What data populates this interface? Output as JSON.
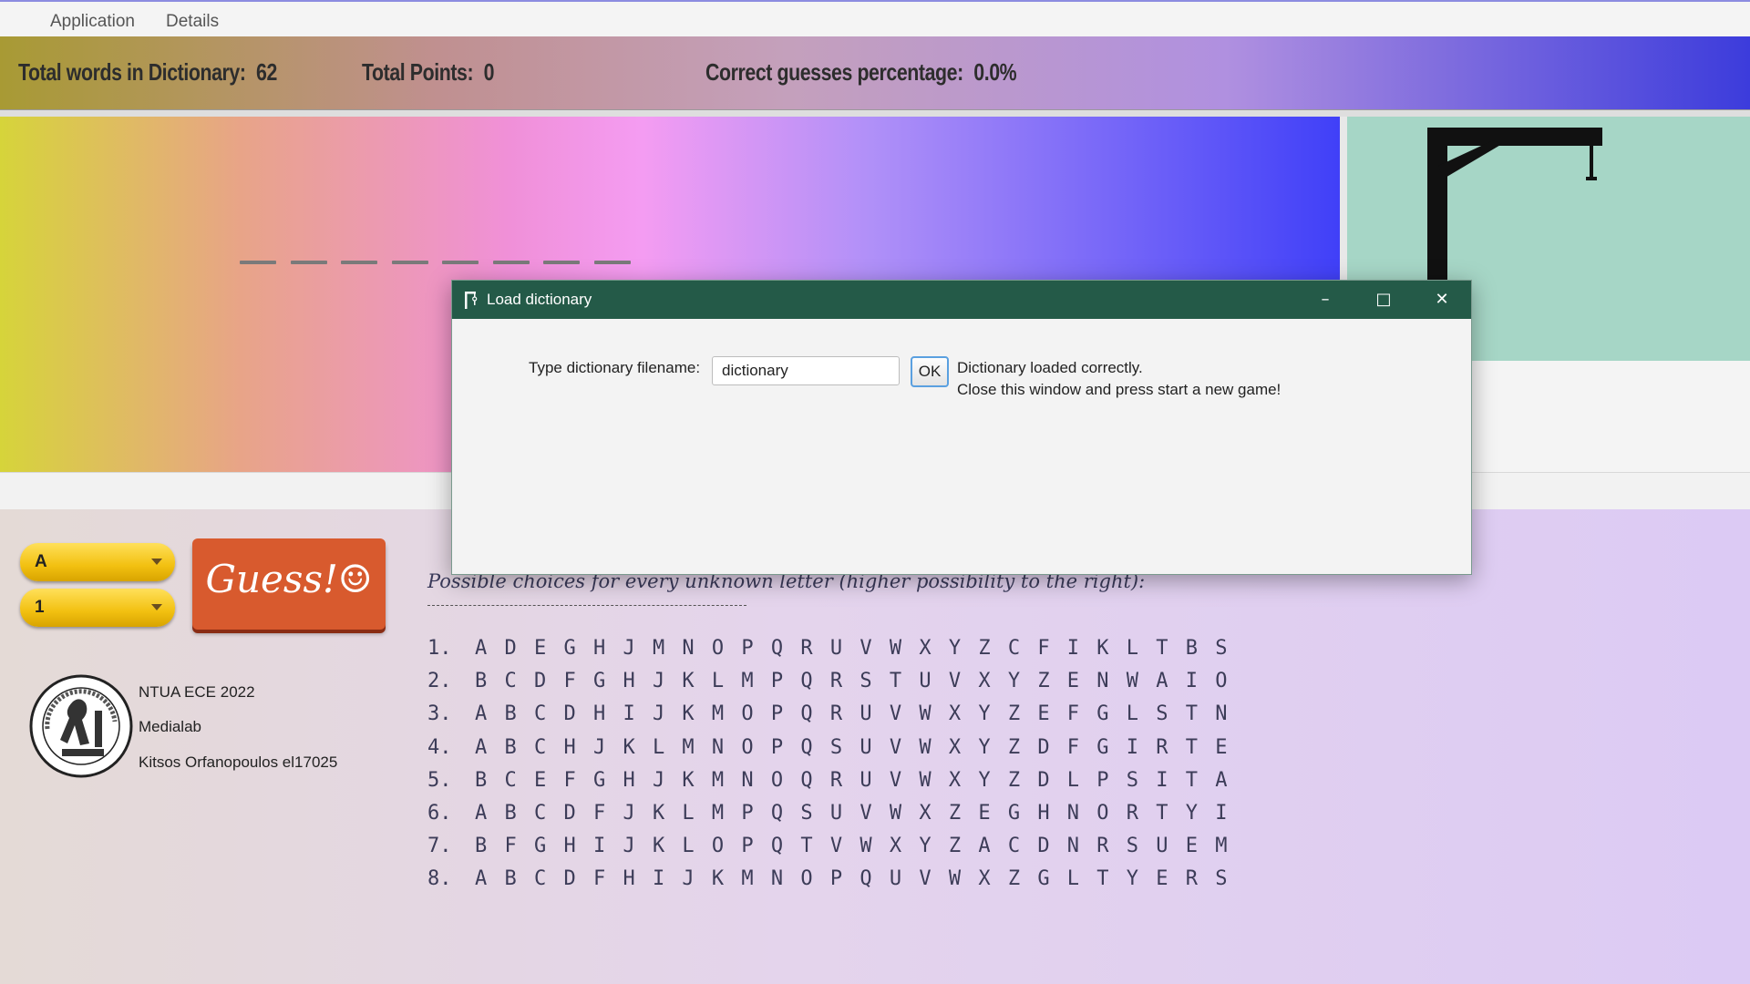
{
  "menu": {
    "items": [
      "Application",
      "Details"
    ]
  },
  "stats": {
    "total_words_label": "Total words in Dictionary:",
    "total_words_value": "62",
    "total_points_label": "Total Points:",
    "total_points_value": "0",
    "correct_label": "Correct guesses percentage:",
    "correct_value": "0.0%"
  },
  "word": {
    "unknown_letters": 8
  },
  "controls": {
    "letter_select": "A",
    "position_select": "1",
    "guess_label": "Guess!☺"
  },
  "credits": {
    "line1": "NTUA ECE 2022",
    "line2": "Medialab",
    "line3": "Kitsos Orfanopoulos el17025",
    "seal_icon": "ntua-seal-icon"
  },
  "choices": {
    "title": "Possible choices for every unknown letter (higher possibility to the right):",
    "rows": [
      {
        "num": "1.",
        "letters": "A D E G H J M N O P Q R U V W X Y Z C F I K L T B S"
      },
      {
        "num": "2.",
        "letters": "B C D F G H J K L M P Q R S T U V X Y Z E N W A I O"
      },
      {
        "num": "3.",
        "letters": "A B C D H I J K M O P Q R U V W X Y Z E F G L S T N"
      },
      {
        "num": "4.",
        "letters": "A B C H J K L M N O P Q S U V W X Y Z D F G I R T E"
      },
      {
        "num": "5.",
        "letters": "B C E F G H J K M N O Q R U V W X Y Z D L P S I T A"
      },
      {
        "num": "6.",
        "letters": "A B C D F J K L M P Q S U V W X Z E G H N O R T Y I"
      },
      {
        "num": "7.",
        "letters": "B F G H I J K L O P Q T V W X Y Z A C D N R S U E M"
      },
      {
        "num": "8.",
        "letters": "A B C D F H I J K M N O P Q U V W X Z G L T Y E R S"
      }
    ]
  },
  "dialog": {
    "title": "Load dictionary",
    "label": "Type dictionary filename:",
    "input_value": "dictionary",
    "ok_label": "OK",
    "message_line1": "Dictionary loaded correctly.",
    "message_line2": "Close this window and press start a new game!",
    "window_buttons": {
      "minimize": "–",
      "maximize": "□",
      "close": "✕"
    }
  },
  "colors": {
    "dialog_titlebar": "#245a48",
    "guess_button": "#d85a2e",
    "combo": "#f2c010",
    "gallows_panel": "#a6d6c6"
  }
}
